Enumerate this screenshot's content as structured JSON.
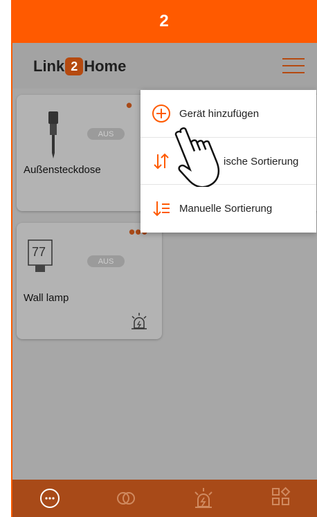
{
  "step": {
    "number": "2"
  },
  "header": {
    "logo_pre": "Link",
    "logo_num": "2",
    "logo_post": "Home"
  },
  "devices": [
    {
      "name": "Außensteckdose",
      "status": "AUS"
    },
    {
      "name": "Wall lamp",
      "status": "AUS",
      "display": "77"
    }
  ],
  "menu": {
    "items": [
      {
        "label": "Gerät hinzufügen"
      },
      {
        "label": "ische Sortierung"
      },
      {
        "label": "Manuelle Sortierung"
      }
    ]
  },
  "colors": {
    "accent": "#ff5a00",
    "brand_dark": "#a84a18",
    "overlay_bg": "#a7a7a7"
  }
}
